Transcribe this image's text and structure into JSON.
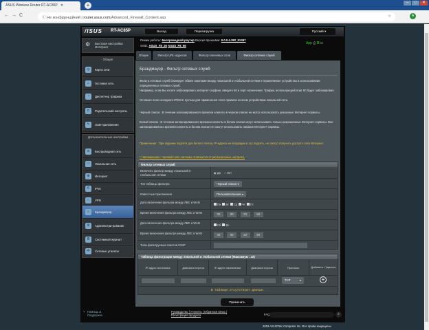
{
  "browser": {
    "tab_title": "ASUS Wireless Router RT-AC85P",
    "new_tab": "+",
    "security": "Не конфіденційний",
    "url_host": "router.asus.com",
    "url_path": "/Advanced_Firewall_Content.asp",
    "avatar": "A"
  },
  "header": {
    "logo": "/ISUS",
    "model": "RT-AC85P",
    "logout": "Выход",
    "reboot": "Перезагрузка",
    "language": "Русский"
  },
  "info": {
    "mode_label": "Режим работы:",
    "mode": "Беспроводной роутер",
    "fw_label": "Версия прошивки:",
    "fw": "9.0.0.4.382_51397",
    "ssid_label": "SSID:",
    "ssid1": "ASUS_F8_26",
    "ssid2": "ASUS_F8_56",
    "app": "App"
  },
  "tabs": [
    "Общие",
    "Фильтр URL-адресов",
    "Фильтр ключевых слов",
    "Фильтр сетевых служб"
  ],
  "sidebar": {
    "quick": "Быстрая настройка Интернет",
    "general": "Общие",
    "general_items": [
      "Карта сети",
      "Гостевая сеть",
      "Диспетчер трафика",
      "Родительский контроль",
      "USB-приложение"
    ],
    "advanced": "Дополнительные настройки",
    "advanced_items": [
      "Беспроводная сеть",
      "Локальная сеть",
      "Интернет",
      "IPv6",
      "VPN",
      "Брандмауэр",
      "Администри-рование",
      "Системный журнал",
      "Сетевые утилиты"
    ]
  },
  "content": {
    "title": "Брандмауэр - Фильтр сетевых служб",
    "p1": "Фильтр сетевых служб блокирует обмен пакетами между локальной и глобальной сетями и ограничивает устройства в использовании определенных сетевых служб.",
    "p2": "Например, если Вы хотите заблокировать интернет-серфинг, введите 80 в порт назначения. Трафик, использующий порт 80 будет заблокирован.",
    "p3": "Оставьте поле исходного IP/MAC пустым для применения этого правила ко всем устройствам локальной сети.",
    "black": "Черный список : В течении запланированного времени клиенты в черном списке не могут использовать указанные Интернет-сервисы.",
    "white": "Белый список : В течении запланированного времени клиенты в белом списке могут использовать только разрешенные Интернет-сервисы. Вне запланированного времени клиенты в белом списке не смогут использовать никакие Интернет-сервисы.",
    "note_label": "Примечание",
    "note": " : При задании подсети для белого списка, IP-адреса не входящие в эту подсеть, не смогут получить доступ к сети Интернет.",
    "reminder": "* Напоминание: Часовой пояс системы отличается от региональных настроек."
  },
  "filter": {
    "header": "Фильтр сетевых служб",
    "rows": [
      {
        "label": "Включить фильтр между локальной и глобальной сетями",
        "yes": "Да",
        "no": "Нет"
      },
      {
        "label": "Тип таблицы фильтра",
        "value": "Черный список"
      },
      {
        "label": "Известные приложения",
        "value": "Пользовательские"
      },
      {
        "label": "Дата включения фильтра между ЛВС и WAN",
        "days": [
          "Пн",
          "Вт",
          "Ср",
          "Чт",
          "Пт"
        ]
      },
      {
        "label": "Время включения фильтра между ЛВС и WAN",
        "time": [
          "00",
          "00",
          "23",
          "59"
        ]
      },
      {
        "label": "Дата включения фильтра между ЛВС и WAN",
        "days": [
          "Сб",
          "Вс"
        ]
      },
      {
        "label": "Время включения фильтра между ЛВС и WAN",
        "time": [
          "00",
          "00",
          "23",
          "59"
        ]
      },
      {
        "label": "Типы фильтруемых пакетов ICMP"
      }
    ]
  },
  "table": {
    "header": "Таблица фильтрации между локальной и глобальной сетями (Максимум : 32)",
    "columns": [
      "IP-адрес источника",
      "Диапазон портов",
      "IP-адрес назначения",
      "Диапазон портов",
      "Протокол",
      "Добавить / Удалить"
    ],
    "protocol": "TCP",
    "empty": "В таблице отсутствуют данные."
  },
  "apply": "Применить",
  "footer": {
    "help": "Помощь & Поддержка",
    "links": "Руководство | Утилиты | Обратная связь | Регистрация продукта",
    "faq": "FAQ",
    "copyright": "2019 ASUSTeK Computer Inc. Все права защищены."
  }
}
